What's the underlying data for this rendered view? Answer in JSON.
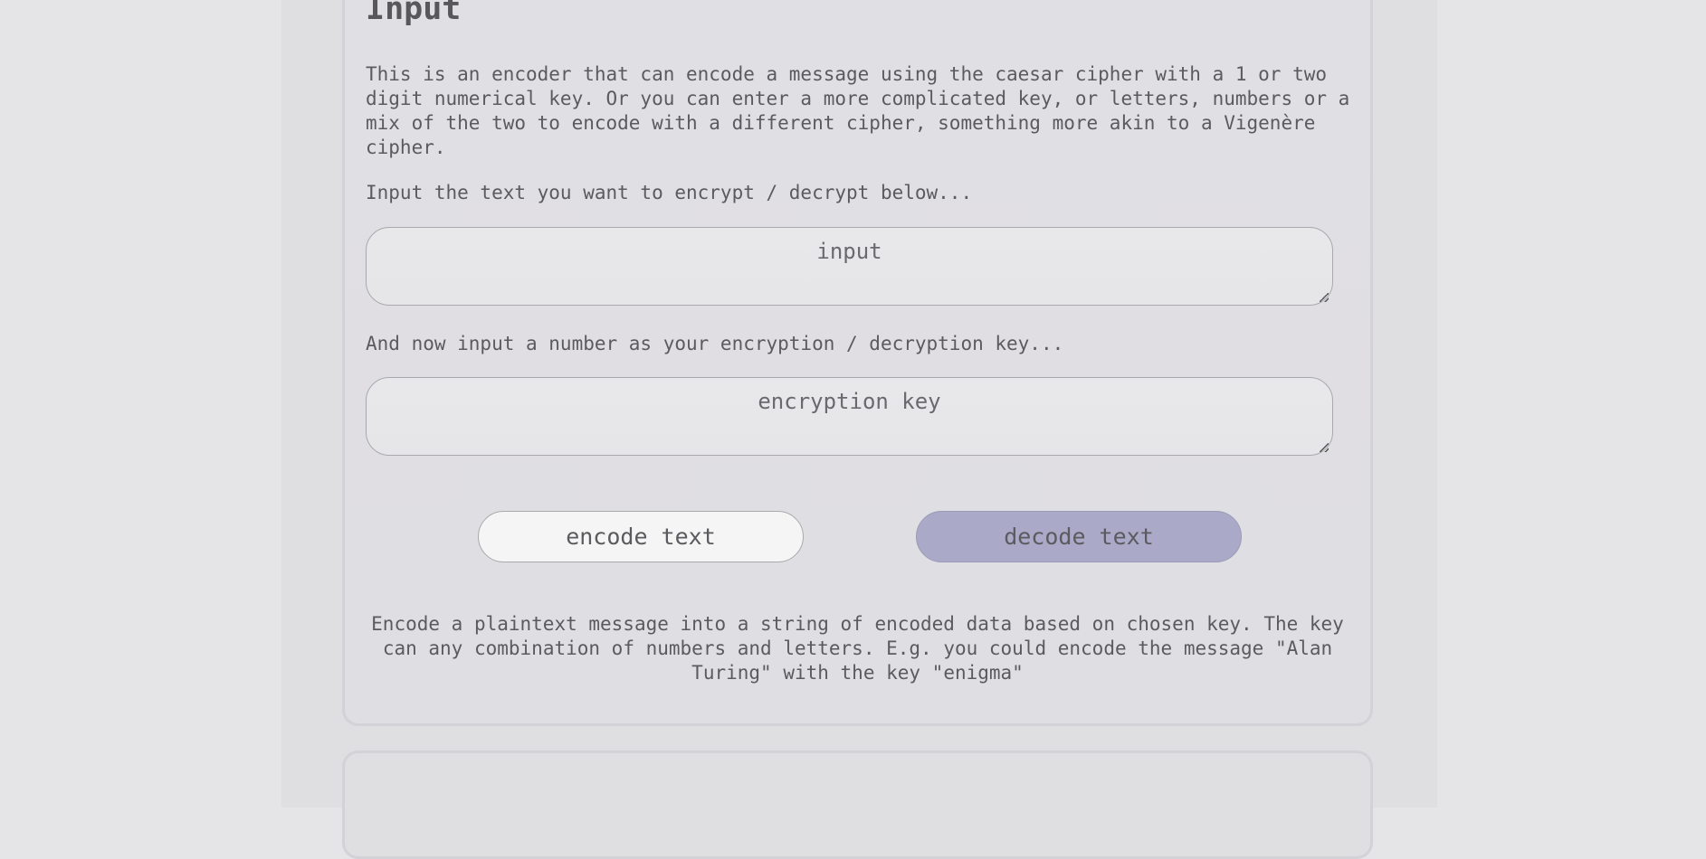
{
  "section": {
    "title": "Input",
    "intro": "This is an encoder that can encode a message using the caesar cipher with a 1 or two digit numerical key. Or you can enter a more complicated key, or letters, numbers or a mix of the two to encode with a different cipher, something more akin to a Vigenère cipher.",
    "text_prompt": "Input the text you want to encrypt / decrypt below...",
    "key_prompt": "And now input a number as your encryption / decryption key..."
  },
  "fields": {
    "input_placeholder": "input",
    "key_placeholder": "encryption key"
  },
  "buttons": {
    "encode_label": "encode text",
    "decode_label": "decode text"
  },
  "description": "Encode a plaintext message into a string of encoded data based on chosen key. The key can any combination of numbers and letters. E.g. you could encode the message \"Alan Turing\" with the key \"enigma\"",
  "colors": {
    "page_background": "#e5e5e7",
    "panel_background": "#dfdee1",
    "decode_button": "#aaa9c8",
    "encode_button": "#f5f5f5"
  }
}
